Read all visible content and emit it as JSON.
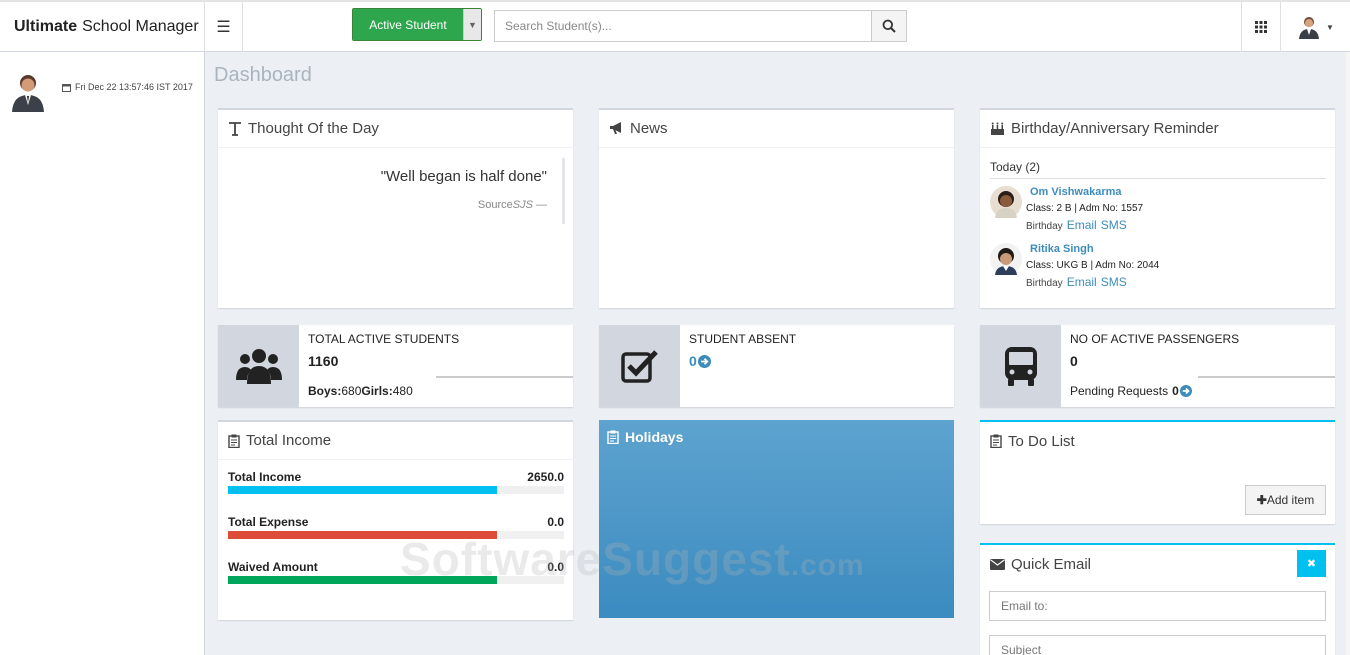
{
  "app": {
    "title_bold": "Ultimate",
    "title_rest": "School Manager"
  },
  "header": {
    "active_button": "Active Student",
    "search_placeholder": "Search Student(s)..."
  },
  "sidebar": {
    "datetime": "Fri Dec 22 13:57:46 IST 2017"
  },
  "page_title": "Dashboard",
  "thought": {
    "title": "Thought Of the Day",
    "quote": "\"Well began is half done\"",
    "source_prefix": "Source",
    "source_name": "SJS",
    "source_suffix": " —"
  },
  "news": {
    "title": "News"
  },
  "birthday": {
    "title": "Birthday/Anniversary Reminder",
    "today_label": "Today (2)",
    "people": [
      {
        "name": "Om Vishwakarma",
        "detail": "Class: 2 B | Adm No: 1557",
        "type": "Birthday",
        "email": "Email",
        "sms": "SMS"
      },
      {
        "name": "Ritika Singh",
        "detail": "Class: UKG B | Adm No: 2044",
        "type": "Birthday",
        "email": "Email",
        "sms": "SMS"
      }
    ]
  },
  "stats": {
    "students": {
      "label": "TOTAL ACTIVE STUDENTS",
      "value": "1160",
      "boys_label": "Boys:",
      "boys": "680",
      "girls_label": "Girls:",
      "girls": "480"
    },
    "absent": {
      "label": "STUDENT ABSENT",
      "value": "0"
    },
    "passengers": {
      "label": "NO OF ACTIVE PASSENGERS",
      "value": "0",
      "pending_label": "Pending Requests",
      "pending": "0"
    }
  },
  "income": {
    "title": "Total Income",
    "rows": [
      {
        "label": "Total Income",
        "value": "2650.0",
        "fill": 0.8,
        "color": "#00c0ef"
      },
      {
        "label": "Total Expense",
        "value": "0.0",
        "fill": 0.8,
        "color": "#dd4b39"
      },
      {
        "label": "Waived Amount",
        "value": "0.0",
        "fill": 0.8,
        "color": "#00a65a"
      }
    ]
  },
  "holidays": {
    "title": "Holidays"
  },
  "todo": {
    "title": "To Do List",
    "add_label": "Add item"
  },
  "quick_email": {
    "title": "Quick Email",
    "to_placeholder": "Email to:",
    "subject_placeholder": "Subject"
  },
  "watermark": {
    "main": "SoftwareSuggest",
    "suffix": ".com"
  }
}
